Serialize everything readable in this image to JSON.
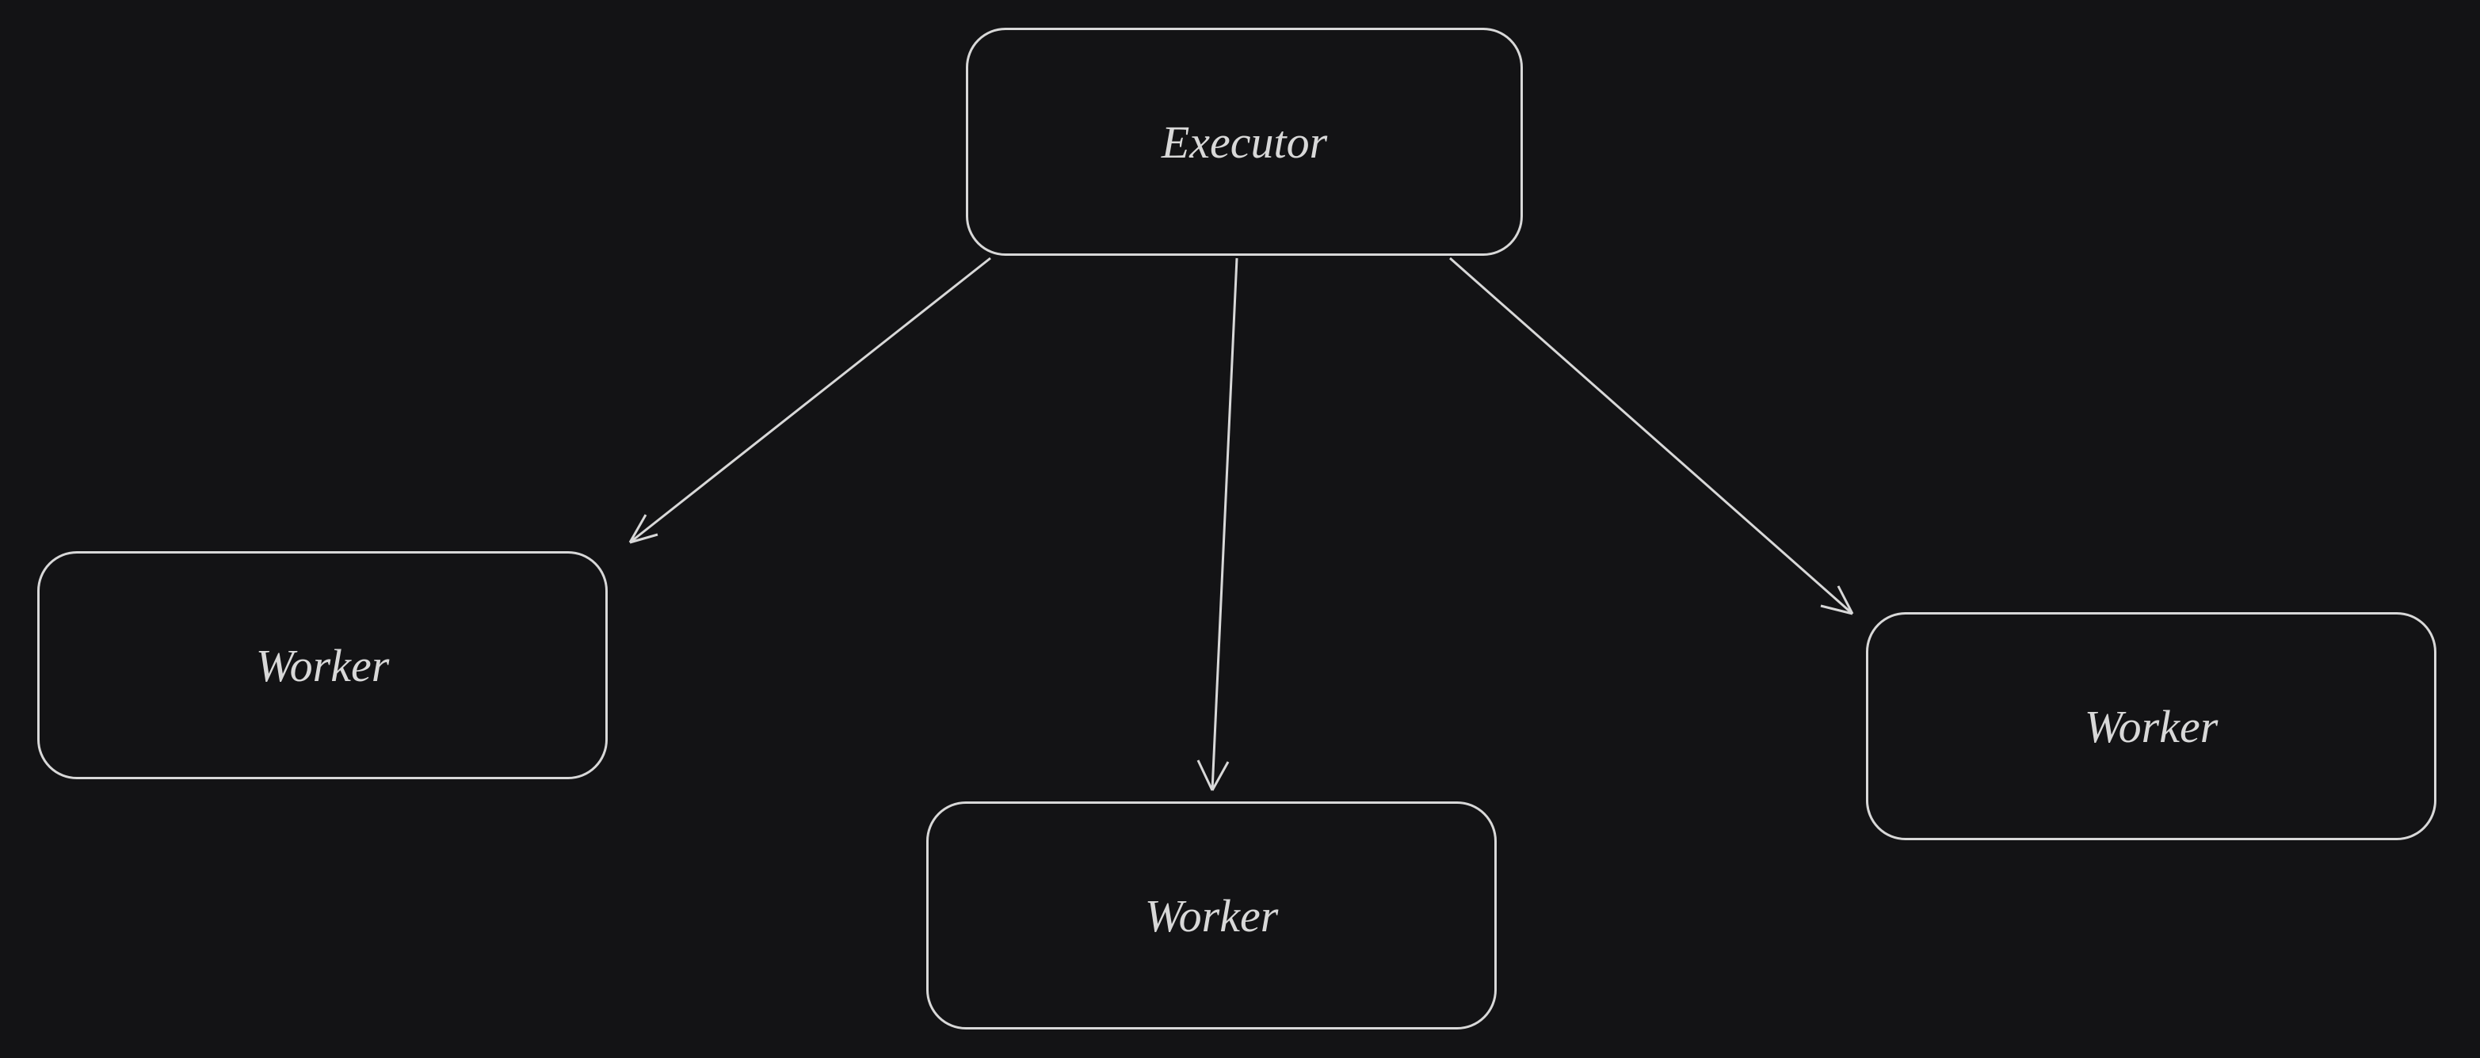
{
  "diagram": {
    "root_label": "Executor",
    "children": [
      {
        "label": "Worker"
      },
      {
        "label": "Worker"
      },
      {
        "label": "Worker"
      }
    ],
    "colors": {
      "background": "#131315",
      "stroke": "#d8d8d8",
      "text": "#d8d8d8"
    }
  }
}
